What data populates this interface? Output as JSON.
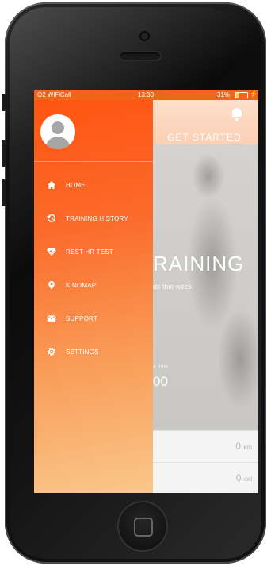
{
  "status_bar": {
    "carrier": "O2 WiFiCall",
    "time": "13:30",
    "battery_percent": "31%",
    "battery_level": 0.31
  },
  "drawer": {
    "menu_items": [
      {
        "label": "HOME",
        "icon": "home-icon"
      },
      {
        "label": "TRAINING HISTORY",
        "icon": "history-icon"
      },
      {
        "label": "REST HR TEST",
        "icon": "heart-rate-icon"
      },
      {
        "label": "KINOMAP",
        "icon": "location-pin-icon"
      },
      {
        "label": "SUPPORT",
        "icon": "mail-icon"
      },
      {
        "label": "SETTINGS",
        "icon": "gear-icon"
      }
    ]
  },
  "background_app": {
    "get_started_label": "GET STARTED",
    "training_title": "RAINING",
    "training_subtitle": "ds this week",
    "stat_label": "a time",
    "stat_value": "00",
    "metrics": [
      {
        "value": "0",
        "unit": "km"
      },
      {
        "value": "0",
        "unit": "cal"
      }
    ]
  },
  "colors": {
    "accent": "#f26418",
    "drawer_top": "#ff5412",
    "drawer_bottom": "#f9c78a"
  }
}
